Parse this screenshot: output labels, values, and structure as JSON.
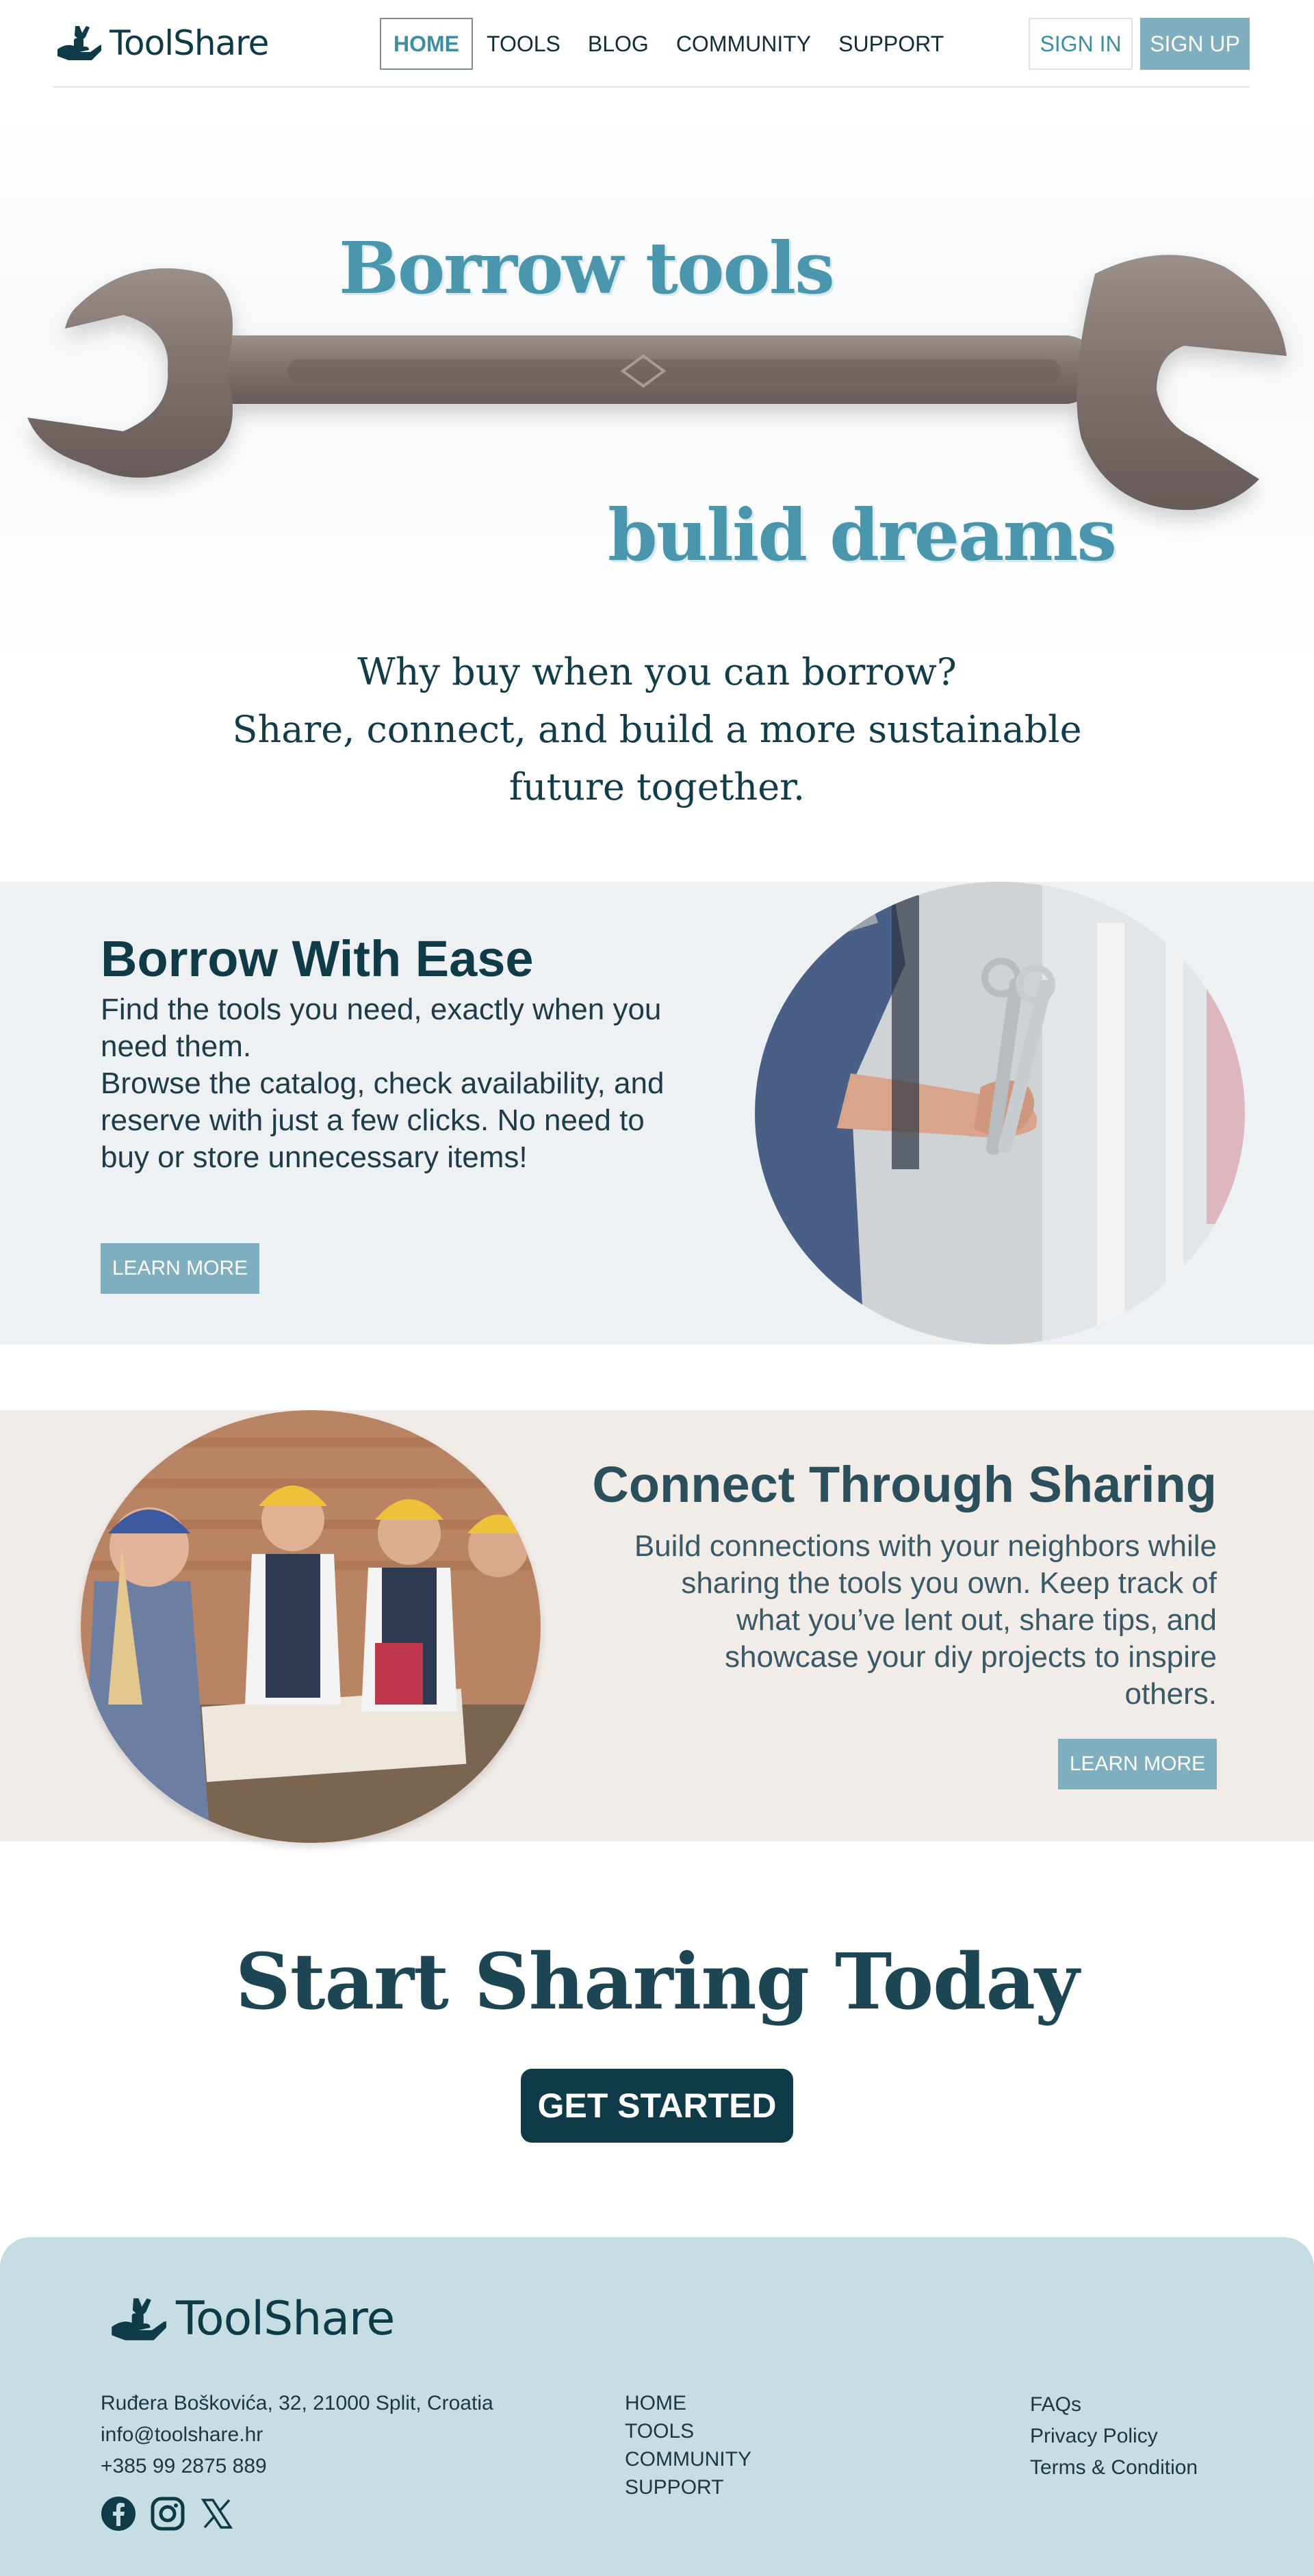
{
  "nav": {
    "brand": "ToolShare",
    "items": [
      {
        "label": "HOME",
        "active": true
      },
      {
        "label": "TOOLS"
      },
      {
        "label": "BLOG"
      },
      {
        "label": "COMMUNITY"
      },
      {
        "label": "SUPPORT"
      }
    ],
    "signin": "SIGN IN",
    "signup": "SIGN UP"
  },
  "hero": {
    "line1": "Borrow tools",
    "line2": "bulid dreams",
    "sub1": "Why buy when you can borrow?",
    "sub2": "Share, connect, and build a more sustainable",
    "sub3": "future together."
  },
  "section1": {
    "title": "Borrow With Ease",
    "p1": "Find the tools you need, exactly when you need them.",
    "p2": "Browse the catalog, check availability, and reserve with just a few clicks. No need to buy or store unnecessary items!",
    "button": "LEARN MORE"
  },
  "section2": {
    "title": "Connect Through Sharing",
    "p": "Build connections with your neighbors while sharing the tools you own. Keep track of what you’ve lent out, share tips, and showcase your diy projects to inspire others.",
    "button": "LEARN MORE"
  },
  "cta": {
    "title": "Start Sharing Today",
    "button": "GET STARTED"
  },
  "footer": {
    "brand": "ToolShare",
    "address": "Ruđera Boškovića, 32, 21000 Split, Croatia",
    "email": "info@toolshare.hr",
    "phone": "+385 99 2875 889",
    "links": [
      "HOME",
      "TOOLS",
      "COMMUNITY",
      "SUPPORT"
    ],
    "legal": [
      "FAQs",
      "Privacy Policy",
      "Terms & Condition"
    ],
    "social_icons": [
      "facebook-icon",
      "instagram-icon",
      "x-icon"
    ]
  },
  "colors": {
    "primary": "#0f3a48",
    "accent": "#7fafbe",
    "hero_text": "#4a97ad",
    "section1_bg": "#eef1f3",
    "section2_bg": "#f2ece9",
    "footer_bg": "#c6dde3"
  }
}
